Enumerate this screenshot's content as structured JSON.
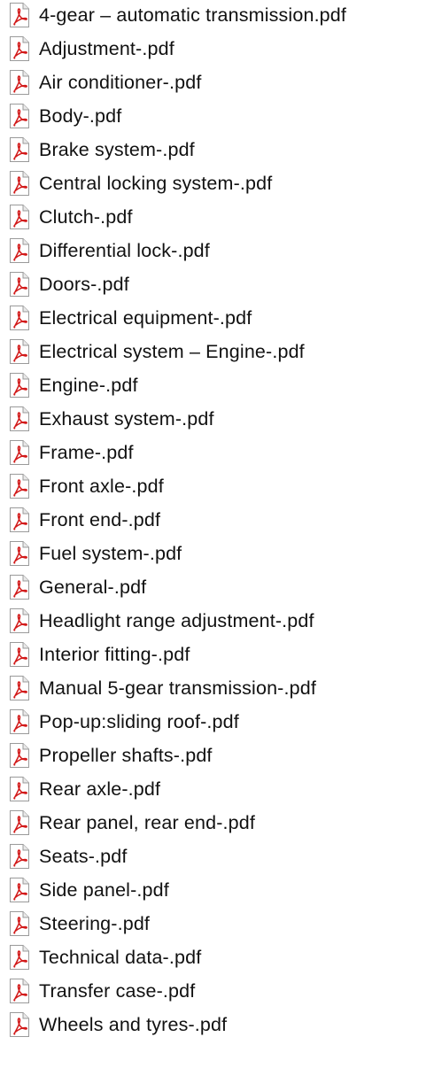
{
  "file_list": {
    "icon": "pdf-file-icon",
    "accent_color": "#d21a1a",
    "items": [
      {
        "label": "4-gear – automatic transmission.pdf"
      },
      {
        "label": "Adjustment-.pdf"
      },
      {
        "label": "Air conditioner-.pdf"
      },
      {
        "label": "Body-.pdf"
      },
      {
        "label": "Brake system-.pdf"
      },
      {
        "label": "Central locking system-.pdf"
      },
      {
        "label": "Clutch-.pdf"
      },
      {
        "label": "Differential lock-.pdf"
      },
      {
        "label": "Doors-.pdf"
      },
      {
        "label": "Electrical equipment-.pdf"
      },
      {
        "label": "Electrical system – Engine-.pdf"
      },
      {
        "label": "Engine-.pdf"
      },
      {
        "label": "Exhaust system-.pdf"
      },
      {
        "label": "Frame-.pdf"
      },
      {
        "label": "Front axle-.pdf"
      },
      {
        "label": "Front end-.pdf"
      },
      {
        "label": "Fuel system-.pdf"
      },
      {
        "label": "General-.pdf"
      },
      {
        "label": "Headlight range adjustment-.pdf"
      },
      {
        "label": "Interior fitting-.pdf"
      },
      {
        "label": "Manual 5-gear transmission-.pdf"
      },
      {
        "label": "Pop-up:sliding roof-.pdf"
      },
      {
        "label": "Propeller shafts-.pdf"
      },
      {
        "label": "Rear axle-.pdf"
      },
      {
        "label": "Rear panel, rear end-.pdf"
      },
      {
        "label": "Seats-.pdf"
      },
      {
        "label": "Side panel-.pdf"
      },
      {
        "label": "Steering-.pdf"
      },
      {
        "label": "Technical data-.pdf"
      },
      {
        "label": "Transfer case-.pdf"
      },
      {
        "label": "Wheels and tyres-.pdf"
      }
    ]
  }
}
